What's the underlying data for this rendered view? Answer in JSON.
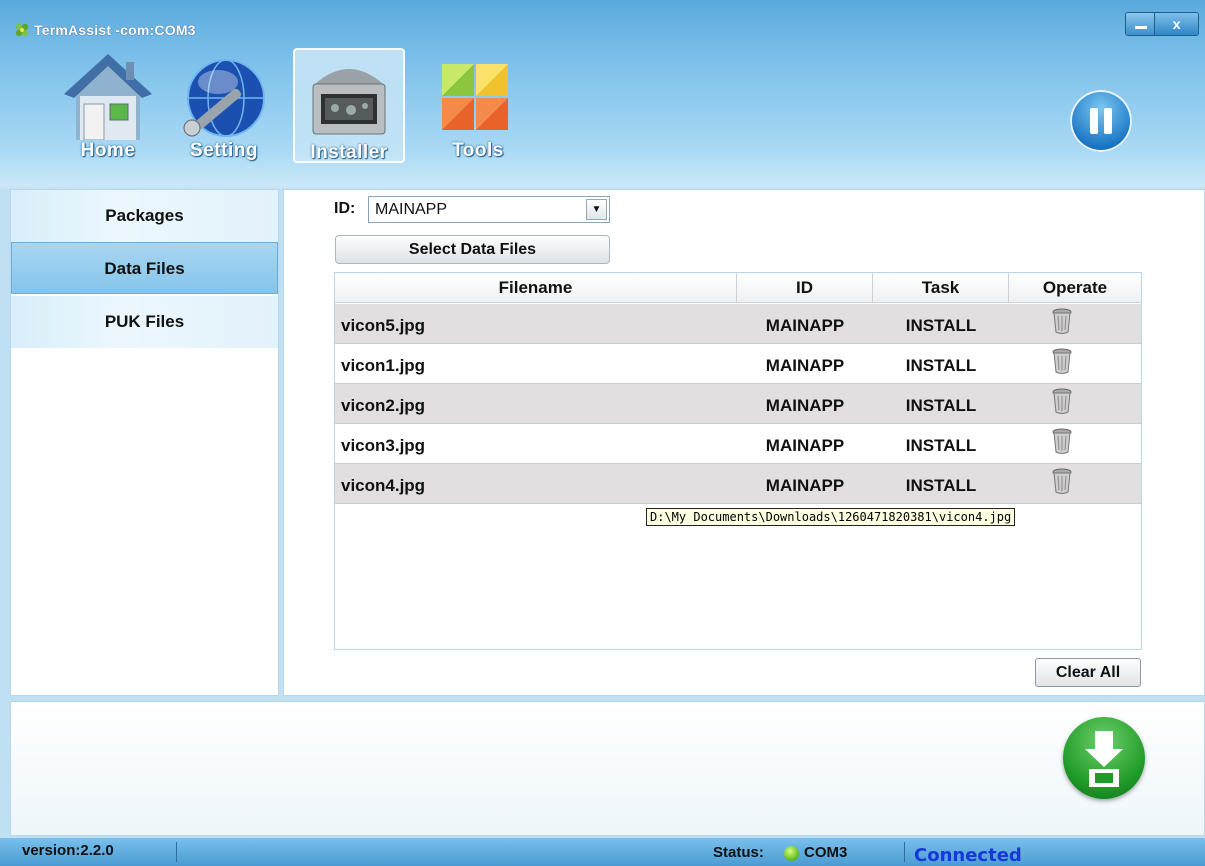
{
  "window": {
    "title": "TermAssist -com:COM3",
    "close_glyph": "x"
  },
  "toolbar": {
    "items": [
      {
        "label": "Home",
        "icon": "home-icon"
      },
      {
        "label": "Setting",
        "icon": "globe-wrench-icon"
      },
      {
        "label": "Installer",
        "icon": "installer-box-icon",
        "selected": true
      },
      {
        "label": "Tools",
        "icon": "tools-tiles-icon"
      }
    ],
    "pause_icon": "pause-icon"
  },
  "sidebar": {
    "items": [
      {
        "label": "Packages"
      },
      {
        "label": "Data Files",
        "selected": true
      },
      {
        "label": "PUK Files"
      }
    ]
  },
  "main": {
    "id_label": "ID:",
    "id_value": "MAINAPP",
    "select_button": "Select Data Files",
    "columns": [
      "Filename",
      "ID",
      "Task",
      "Operate"
    ],
    "rows": [
      {
        "filename": "vicon5.jpg",
        "id": "MAINAPP",
        "task": "INSTALL"
      },
      {
        "filename": "vicon1.jpg",
        "id": "MAINAPP",
        "task": "INSTALL"
      },
      {
        "filename": "vicon2.jpg",
        "id": "MAINAPP",
        "task": "INSTALL"
      },
      {
        "filename": "vicon3.jpg",
        "id": "MAINAPP",
        "task": "INSTALL"
      },
      {
        "filename": "vicon4.jpg",
        "id": "MAINAPP",
        "task": "INSTALL"
      }
    ],
    "tooltip": "D:\\My Documents\\Downloads\\1260471820381\\vicon4.jpg",
    "clear_button": "Clear All"
  },
  "bottom": {
    "install_icon": "download-install-icon"
  },
  "statusbar": {
    "version": "version:2.2.0",
    "status_label": "Status:",
    "port": "COM3",
    "connection": "Connected",
    "colors": {
      "connected_text": "#1638d8",
      "status_dot": "#6cc31f"
    }
  }
}
